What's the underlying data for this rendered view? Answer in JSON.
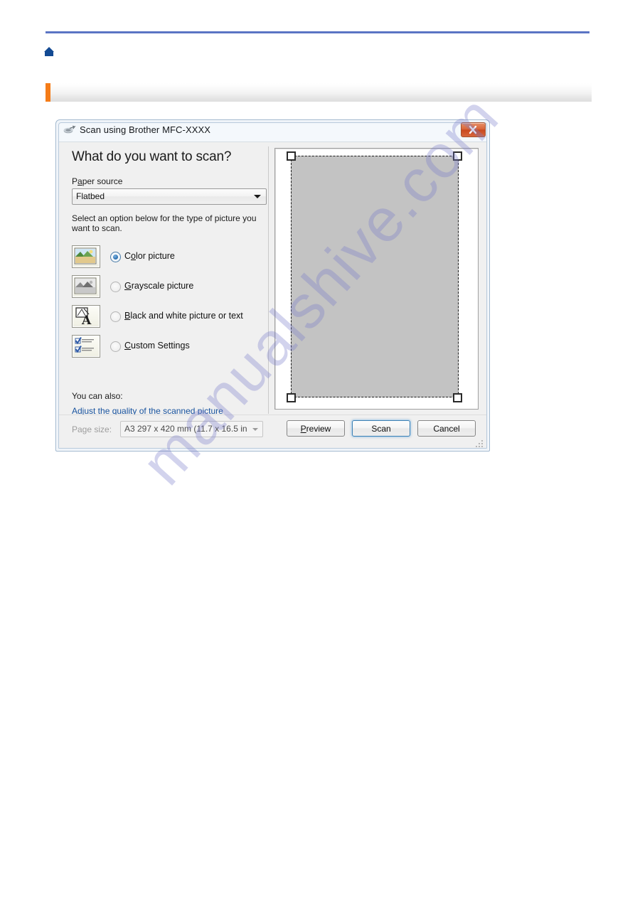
{
  "page": {
    "heading_text": "",
    "home_icon": "home-icon",
    "watermark": "manualshive.com"
  },
  "dialog": {
    "title": "Scan using Brother MFC-XXXX",
    "title_icon": "scanner-icon",
    "close_label": "x",
    "question": "What do you want to scan?",
    "paper_source": {
      "label_pre": "P",
      "label_accel": "a",
      "label_post": "per source",
      "value": "Flatbed"
    },
    "instruction": "Select an option below for the type of picture you want to scan.",
    "options": [
      {
        "icon": "color-picture-icon",
        "pre": "C",
        "accel": "o",
        "post": "lor picture",
        "selected": true
      },
      {
        "icon": "grayscale-picture-icon",
        "pre": "",
        "accel": "G",
        "post": "rayscale picture",
        "selected": false
      },
      {
        "icon": "black-and-white-text-icon",
        "pre": "",
        "accel": "B",
        "post": "lack and white picture or text",
        "selected": false
      },
      {
        "icon": "custom-settings-icon",
        "pre": "",
        "accel": "C",
        "post": "ustom Settings",
        "selected": false
      }
    ],
    "you_can_also": "You can also:",
    "quality_link": "Adjust the quality of the scanned picture",
    "page_size": {
      "label": "Page size:",
      "value": "A3 297 x 420 mm (11.7 x 16.5 in"
    },
    "buttons": {
      "preview_pre": "",
      "preview_accel": "P",
      "preview_post": "review",
      "scan": "Scan",
      "cancel": "Cancel"
    }
  },
  "colors": {
    "rule": "#5b74c4",
    "accent": "#f57c18",
    "link": "#17529e",
    "selection": "#c3c3c3",
    "default_button_border": "#3c7fb1"
  }
}
